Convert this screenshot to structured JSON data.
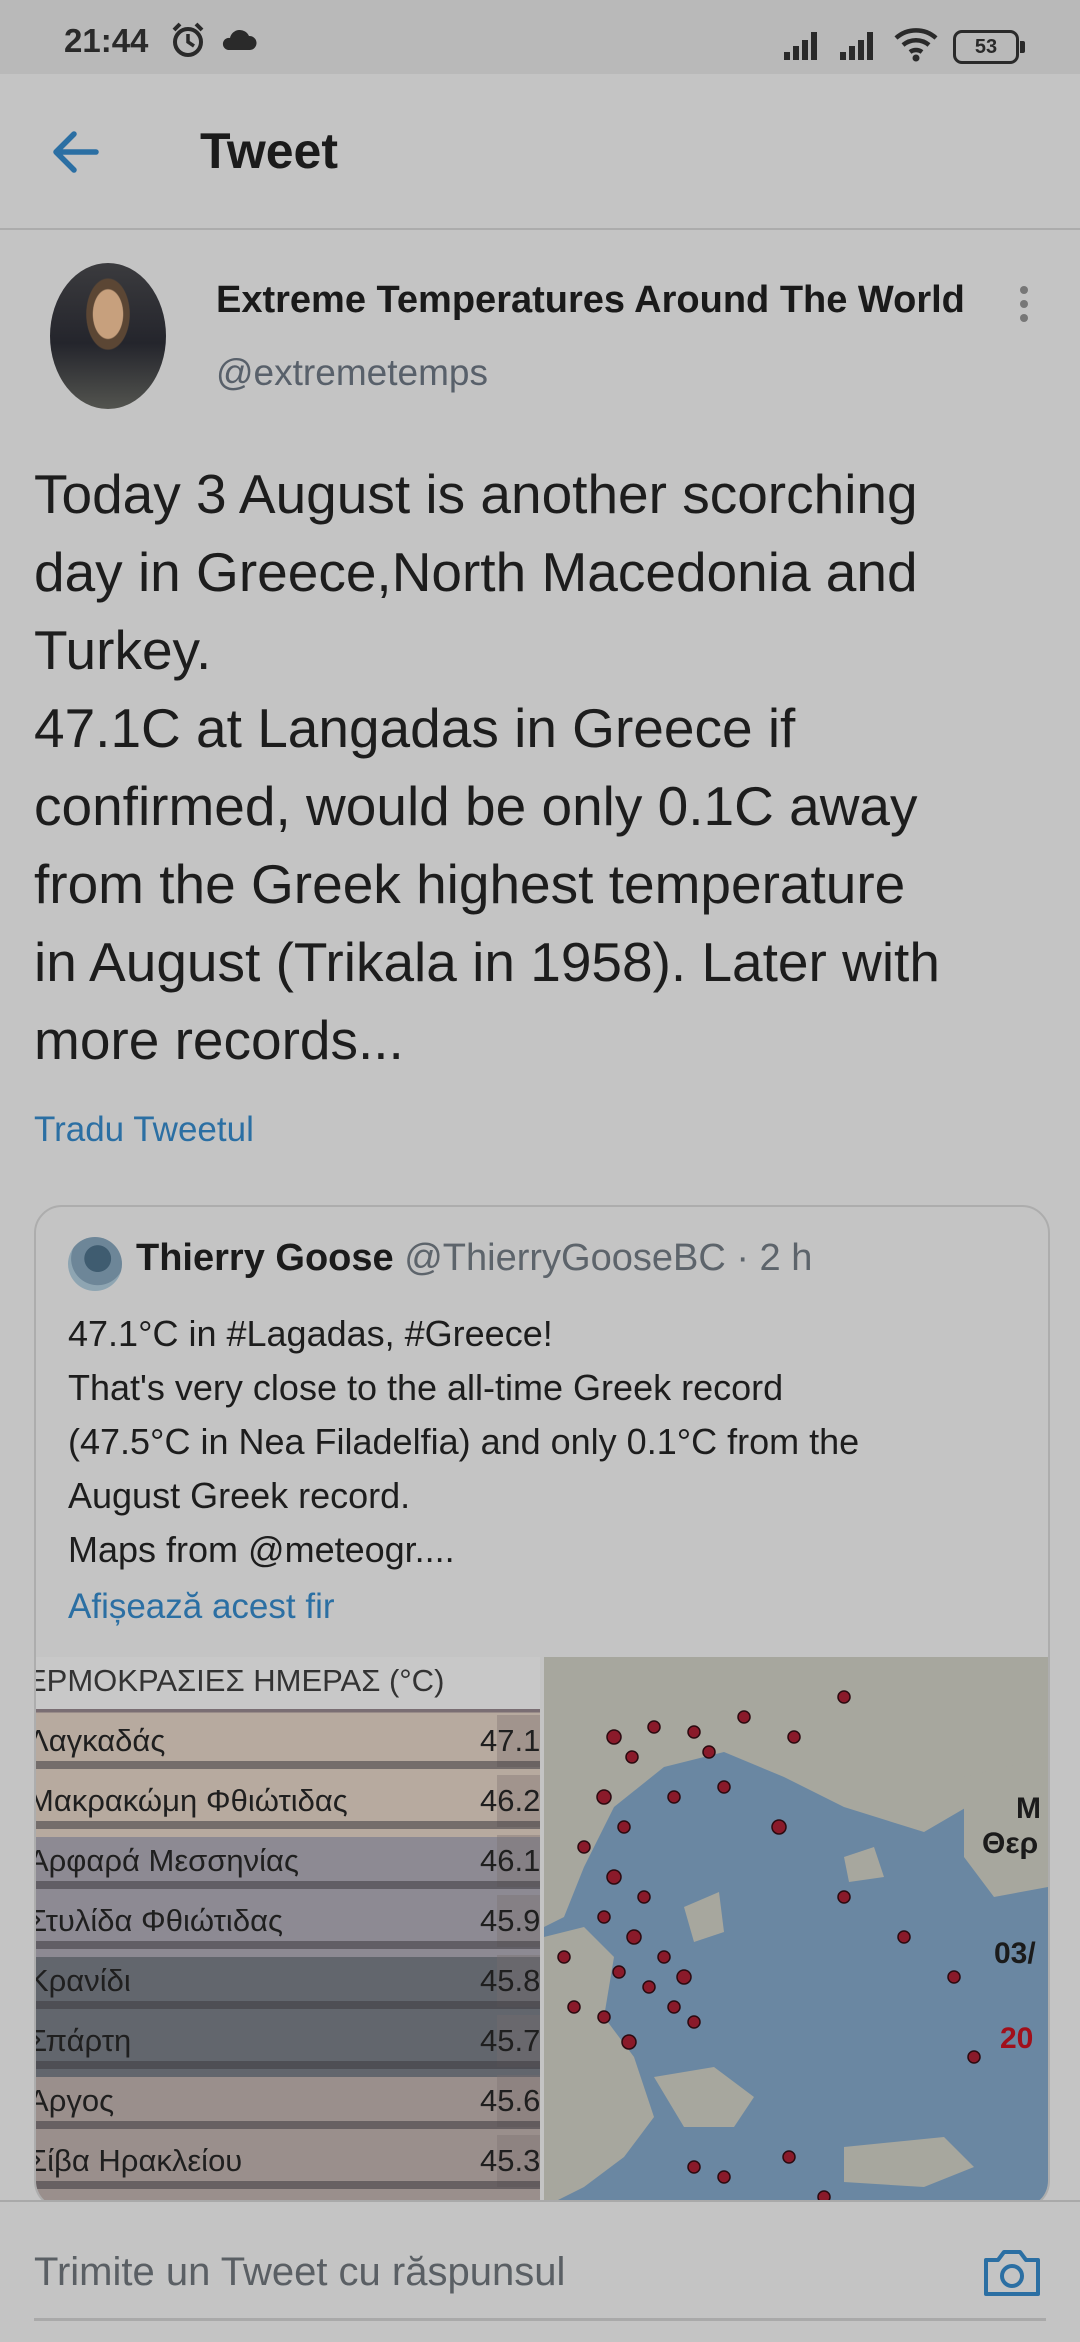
{
  "status_bar": {
    "time": "21:44",
    "battery": "53"
  },
  "header": {
    "title": "Tweet"
  },
  "tweet": {
    "author_name": "Extreme Temperatures Around The World",
    "author_handle": "@extremetemps",
    "text_lines": [
      "Today 3 August is another scorching",
      "day in Greece,North Macedonia and",
      "Turkey.",
      "47.1C at Langadas in Greece if",
      "confirmed, would be only 0.1C away",
      "from the Greek highest temperature",
      "in August (Trikala in 1958). Later with",
      "more records..."
    ],
    "translate_label": "Tradu Tweetul"
  },
  "quoted_tweet": {
    "name": "Thierry Goose",
    "meta": "@ThierryGooseBC · 2 h",
    "text_lines": [
      "47.1°C in #Lagadas, #Greece!",
      "That's very close to the all-time Greek record",
      "(47.5°C in Nea Filadelfia) and only 0.1°C from the",
      "August Greek record.",
      "Maps from @meteogr...."
    ],
    "thread_link": "Afișează acest fir",
    "media_table": {
      "title": "ΕΡΜΟΚΡΑΣΙΕΣ ΗΜΕΡΑΣ (°C)",
      "rows": [
        {
          "place": "Λαγκαδάς",
          "value": "47.1"
        },
        {
          "place": "Μακρακώμη Φθιώτιδας",
          "value": "46.2"
        },
        {
          "place": "Αρφαρά Μεσσηνίας",
          "value": "46.1"
        },
        {
          "place": "Στυλίδα Φθιώτιδας",
          "value": "45.9"
        },
        {
          "place": "Κρανίδι",
          "value": "45.8"
        },
        {
          "place": "Σπάρτη",
          "value": "45.7"
        },
        {
          "place": "Άργος",
          "value": "45.6"
        },
        {
          "place": "Σίβα Ηρακλείου",
          "value": "45.3"
        }
      ]
    },
    "map_labels": [
      "Μ",
      "Θερ",
      "03/",
      "20"
    ]
  },
  "reply": {
    "placeholder": "Trimite un Tweet cu răspunsul"
  },
  "colors": {
    "link": "#2b6fa3",
    "overlay_bg": "#c4c4c4",
    "map_sea": "#6a87a2",
    "map_land": "#a7a79e",
    "dot": "#8a1a2a"
  }
}
